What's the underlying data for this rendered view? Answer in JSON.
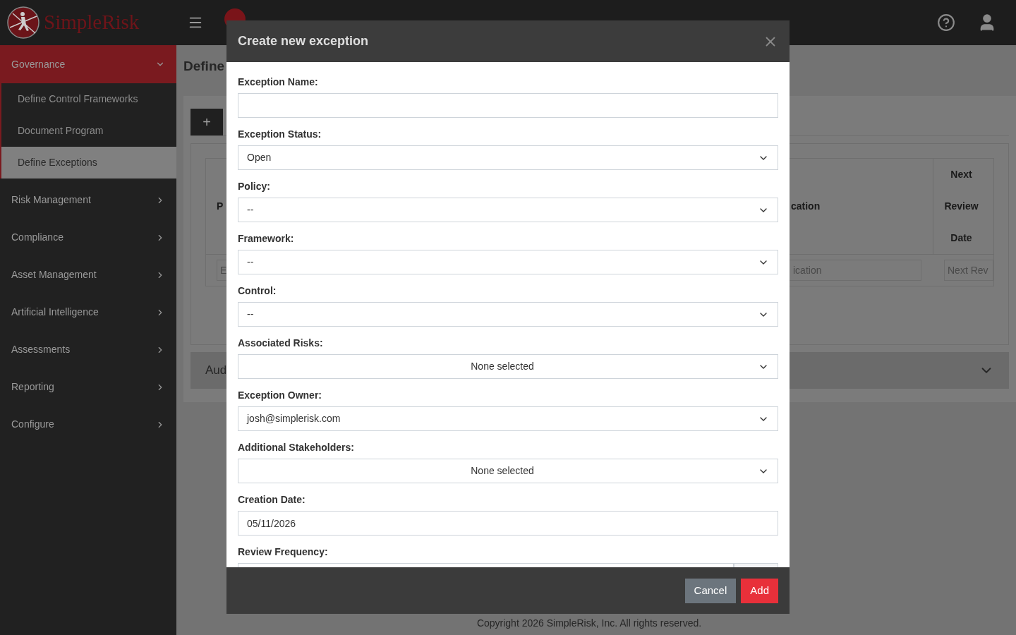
{
  "header": {
    "logo_text": "SimpleRisk"
  },
  "sidebar": {
    "items": [
      {
        "label": "Governance",
        "expanded": true,
        "children": [
          {
            "label": "Define Control Frameworks",
            "selected": false
          },
          {
            "label": "Document Program",
            "selected": false
          },
          {
            "label": "Define Exceptions",
            "selected": true
          }
        ]
      },
      {
        "label": "Risk Management",
        "expanded": false
      },
      {
        "label": "Compliance",
        "expanded": false
      },
      {
        "label": "Asset Management",
        "expanded": false
      },
      {
        "label": "Artificial Intelligence",
        "expanded": false
      },
      {
        "label": "Assessments",
        "expanded": false
      },
      {
        "label": "Reporting",
        "expanded": false
      },
      {
        "label": "Configure",
        "expanded": false
      }
    ]
  },
  "page": {
    "title": "Define",
    "add_button": "+",
    "table": {
      "columns": [
        "P",
        "cation",
        "Next Review Date"
      ],
      "filters": [
        {
          "placeholder": "E"
        },
        {
          "placeholder": "ication"
        },
        {
          "placeholder": "Next Rev"
        }
      ]
    },
    "accordion": {
      "title": "Aud"
    },
    "footer": "Copyright 2026 SimpleRisk, Inc. All rights reserved."
  },
  "modal": {
    "title": "Create new exception",
    "fields": [
      {
        "label": "Exception Name:",
        "kind": "text"
      },
      {
        "label": "Exception Status:",
        "kind": "select",
        "value": "Open"
      },
      {
        "label": "Policy:",
        "kind": "select",
        "value": "--"
      },
      {
        "label": "Framework:",
        "kind": "select",
        "value": "--"
      },
      {
        "label": "Control:",
        "kind": "select",
        "value": "--"
      },
      {
        "label": "Associated Risks:",
        "kind": "multiselect",
        "value": "None selected"
      },
      {
        "label": "Exception Owner:",
        "kind": "select",
        "value": "josh@simplerisk.com"
      },
      {
        "label": "Additional Stakeholders:",
        "kind": "multiselect",
        "value": "None selected"
      },
      {
        "label": "Creation Date:",
        "kind": "text",
        "value": "05/11/2026"
      },
      {
        "label": "Review Frequency:",
        "kind": "number"
      }
    ],
    "buttons": [
      {
        "label": "Cancel",
        "kind": "secondary"
      },
      {
        "label": "Add",
        "kind": "primary"
      }
    ]
  }
}
